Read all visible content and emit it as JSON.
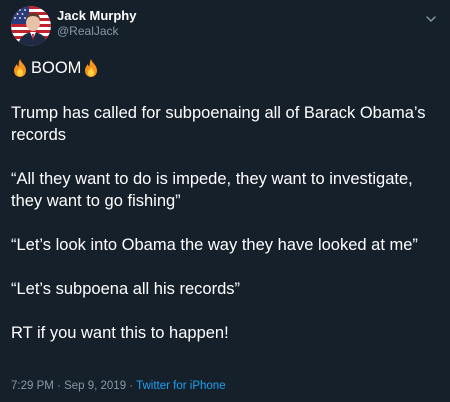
{
  "author": {
    "display_name": "Jack Murphy",
    "handle": "@RealJack"
  },
  "tweet": {
    "boom_text": "BOOM",
    "paragraphs": [
      "Trump has called for subpoenaing all of Barack Obama’s records",
      "“All they want to do is impede, they want to investigate, they want to go fishing”",
      "“Let’s look into Obama the way they have looked at me”",
      "“Let’s subpoena all his records”",
      "RT if you want this to happen!"
    ],
    "time": "7:29 PM",
    "separator": " · ",
    "date": "Sep 9, 2019",
    "separator2": " · ",
    "source": "Twitter for iPhone"
  },
  "icons": {
    "fire": "fire-emoji-icon",
    "caret": "chevron-down-icon",
    "avatar_flag": "us-flag-avatar"
  },
  "colors": {
    "background": "#15202b",
    "text": "#ffffff",
    "secondary_text": "#8899a6",
    "link": "#1da1f2"
  }
}
